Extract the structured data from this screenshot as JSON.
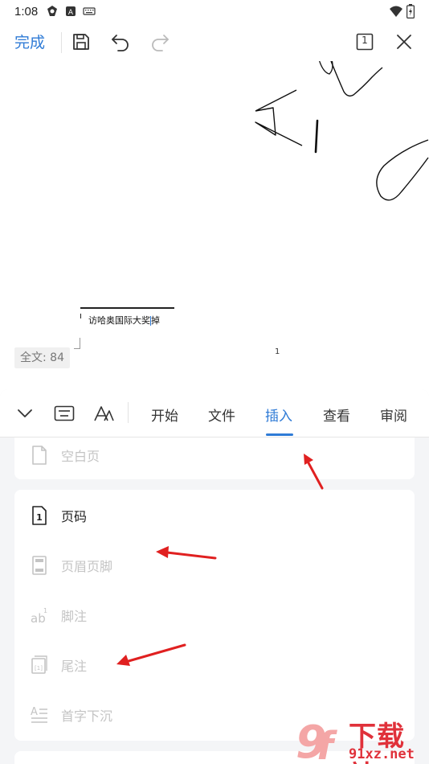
{
  "status_bar": {
    "time": "1:08"
  },
  "toolbar": {
    "done_label": "完成",
    "page_view_number": "1"
  },
  "document": {
    "text": "访哈奥国际大奖",
    "text_tail": "掉",
    "page_number": "1",
    "word_count": "全文: 84"
  },
  "panel": {
    "tabs": [
      {
        "label": "开始"
      },
      {
        "label": "文件"
      },
      {
        "label": "插入"
      },
      {
        "label": "查看"
      },
      {
        "label": "审阅"
      }
    ],
    "active_tab": "插入",
    "items": {
      "blank_page": "空白页",
      "page_number": "页码",
      "header_footer": "页眉页脚",
      "footnote": "脚注",
      "endnote": "尾注",
      "drop_cap": "首字下沉"
    }
  },
  "colors": {
    "accent": "#2f7bd6",
    "disabled": "#c4c4c4",
    "annotation_arrow": "#e02020"
  },
  "watermark": {
    "brand_text": "下载站",
    "domain": "91xz.net"
  }
}
